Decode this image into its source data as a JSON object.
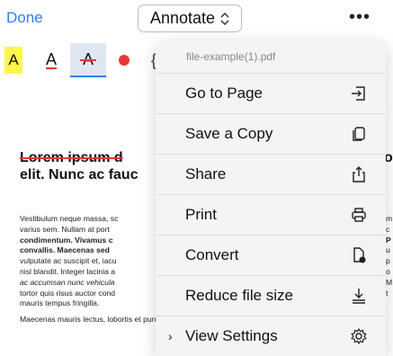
{
  "header": {
    "done_label": "Done",
    "mode_label": "Annotate",
    "mode_icon": "chevron-up-down-icon",
    "more_icon": "ellipsis-icon"
  },
  "toolbar": {
    "highlight_label": "A",
    "underline_label": "A",
    "strikethrough_label": "A",
    "highlight_color": "#fff64d",
    "annotation_color": "#e53935",
    "selected_tool": "strikethrough"
  },
  "document": {
    "title_line1_struck": "Lorem ipsum d",
    "title_line1_right": "o",
    "title_line2": "elit. Nunc ac fauc",
    "body_lines": [
      "Vestibulum neque massa, sc",
      "varius sem. Nullam at port",
      "condimentum. Vivamus c",
      "convallis. Maecenas sed",
      "vulputate ac suscipit et, iacu",
      "nisl blandit. Integer lacinia a",
      "ac accumsan nunc vehicula",
      "tortor quis risus auctor cond",
      "mauris tempus fringilla."
    ],
    "last_line": "Maecenas mauris lectus, lobortis et purus mattis, blandit dictum tellus.",
    "right_fragments": [
      "m",
      "c",
      "P",
      "u",
      "p",
      "o",
      "M",
      "t"
    ]
  },
  "menu": {
    "filename": "file-example(1).pdf",
    "items": [
      {
        "label": "Go to Page",
        "icon": "go-to-page-icon"
      },
      {
        "label": "Save a Copy",
        "icon": "copy-icon"
      },
      {
        "label": "Share",
        "icon": "share-icon"
      },
      {
        "label": "Print",
        "icon": "printer-icon"
      },
      {
        "label": "Convert",
        "icon": "convert-document-icon"
      },
      {
        "label": "Reduce file size",
        "icon": "download-compress-icon"
      },
      {
        "label": "View Settings",
        "icon": "gear-icon",
        "chevron": "›"
      }
    ]
  }
}
